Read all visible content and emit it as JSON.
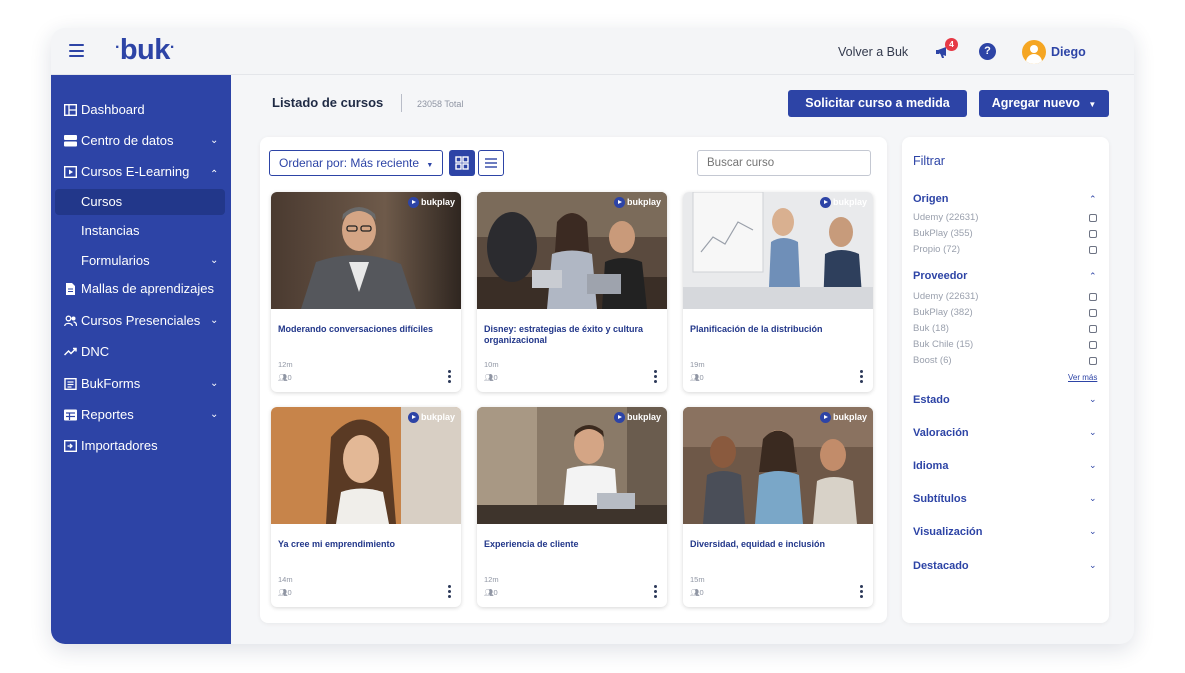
{
  "header": {
    "logo": "buk",
    "volver_label": "Volver a Buk",
    "notifications_count": "4",
    "help_label": "?",
    "user_name": "Diego"
  },
  "sidebar": {
    "items": [
      {
        "label": "Dashboard",
        "icon": "dashboard-icon"
      },
      {
        "label": "Centro de datos",
        "icon": "database-icon",
        "chevron": "⌄"
      },
      {
        "label": "Cursos E-Learning",
        "icon": "play-square-icon",
        "chevron": "⌃"
      },
      {
        "label": "Cursos"
      },
      {
        "label": "Instancias"
      },
      {
        "label": "Formularios",
        "chevron": "⌄"
      },
      {
        "label": "Mallas de aprendizajes",
        "icon": "document-icon"
      },
      {
        "label": "Cursos Presenciales",
        "icon": "people-icon",
        "chevron": "⌄"
      },
      {
        "label": "DNC",
        "icon": "trend-icon"
      },
      {
        "label": "BukForms",
        "icon": "form-icon",
        "chevron": "⌄"
      },
      {
        "label": "Reportes",
        "icon": "report-icon",
        "chevron": "⌄"
      },
      {
        "label": "Importadores",
        "icon": "import-icon"
      }
    ]
  },
  "main": {
    "title": "Listado de cursos",
    "total": "23058 Total",
    "request_button": "Solicitar curso a medida",
    "add_button": "Agregar nuevo"
  },
  "toolbar": {
    "sort_label": "Ordenar por: Más reciente",
    "search_placeholder": "Buscar curso"
  },
  "courses": [
    {
      "title": "Moderando conversaciones difíciles",
      "duration": "12m",
      "users": "0",
      "badge": "bukplay"
    },
    {
      "title": "Disney: estrategias de éxito y cultura organizacional",
      "duration": "10m",
      "users": "0",
      "badge": "bukplay"
    },
    {
      "title": "Planificación de la distribución",
      "duration": "19m",
      "users": "0",
      "badge": "bukplay"
    },
    {
      "title": "Ya cree mi emprendimiento",
      "duration": "14m",
      "users": "0",
      "badge": "bukplay"
    },
    {
      "title": "Experiencia de cliente",
      "duration": "12m",
      "users": "0",
      "badge": "bukplay"
    },
    {
      "title": "Diversidad, equidad e inclusión",
      "duration": "15m",
      "users": "0",
      "badge": "bukplay"
    }
  ],
  "filters": {
    "title": "Filtrar",
    "origen": {
      "label": "Origen",
      "options": [
        "Udemy (22631)",
        "BukPlay (355)",
        "Propio (72)"
      ]
    },
    "proveedor": {
      "label": "Proveedor",
      "options": [
        "Udemy (22631)",
        "BukPlay (382)",
        "Buk (18)",
        "Buk Chile (15)",
        "Boost (6)"
      ],
      "more": "Ver más"
    },
    "collapsed": [
      "Estado",
      "Valoración",
      "Idioma",
      "Subtítulos",
      "Visualización",
      "Destacado"
    ]
  },
  "colors": {
    "primary": "#2d44a6",
    "sidebar_active": "#22378a",
    "badge": "#e63946",
    "avatar": "#f5a623"
  }
}
